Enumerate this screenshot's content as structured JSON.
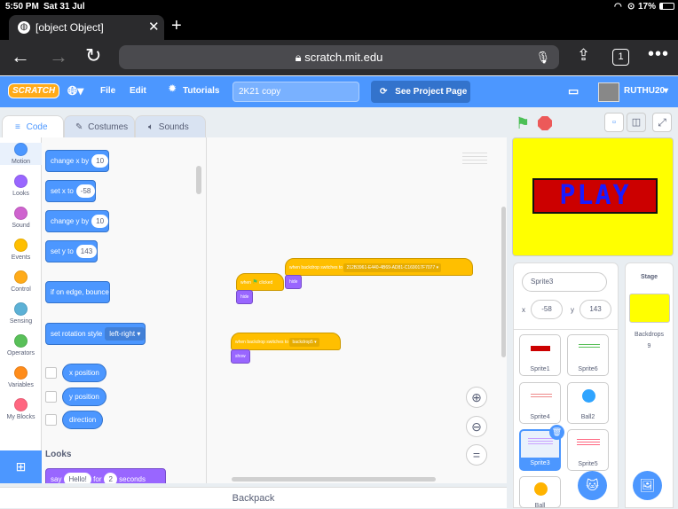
{
  "status_bar": {
    "time": "5:50 PM",
    "date": "Sat 31 Jul",
    "battery": "17%"
  },
  "browser": {
    "tab_title": "[object Object]",
    "url": "scratch.mit.edu",
    "tabs_count": "1"
  },
  "menubar": {
    "logo": "SCRATCH",
    "file": "File",
    "edit": "Edit",
    "tutorials": "Tutorials",
    "project_title": "2K21 copy",
    "see_project": "See Project Page",
    "username": "RUTHU20"
  },
  "editor_tabs": {
    "code": "Code",
    "costumes": "Costumes",
    "sounds": "Sounds"
  },
  "categories": [
    {
      "label": "Motion",
      "color": "#4c97ff"
    },
    {
      "label": "Looks",
      "color": "#9966ff"
    },
    {
      "label": "Sound",
      "color": "#cf63cf"
    },
    {
      "label": "Events",
      "color": "#ffbf00"
    },
    {
      "label": "Control",
      "color": "#ffab19"
    },
    {
      "label": "Sensing",
      "color": "#5cb1d6"
    },
    {
      "label": "Operators",
      "color": "#59c059"
    },
    {
      "label": "Variables",
      "color": "#ff8c1a"
    },
    {
      "label": "My Blocks",
      "color": "#ff6680"
    }
  ],
  "palette": {
    "change_x": {
      "label": "change x by",
      "value": "10"
    },
    "set_x": {
      "label": "set x to",
      "value": "-58"
    },
    "change_y": {
      "label": "change y by",
      "value": "10"
    },
    "set_y": {
      "label": "set y to",
      "value": "143"
    },
    "bounce": "if on edge, bounce",
    "rotation": {
      "label": "set rotation style",
      "value": "left-right"
    },
    "x_position": "x position",
    "y_position": "y position",
    "direction": "direction",
    "looks_header": "Looks",
    "say": {
      "label": "say",
      "text": "Hello!",
      "for": "for",
      "secs": "2",
      "unit": "seconds"
    }
  },
  "code": {
    "when_flag_clicked_a": "when",
    "when_flag_clicked_b": "clicked",
    "hide1": "hide",
    "backdrop_switch1": "when backdrop switches to",
    "backdrop_value1": "212B3961-E440-4B69-AD81-C169017F7077",
    "hide2": "hide",
    "backdrop_switch2": "when backdrop switches to",
    "backdrop_value2": "backdrop5",
    "show": "show"
  },
  "stage": {
    "play_text": "PLAY"
  },
  "sprite_info": {
    "name": "Sprite3",
    "x_label": "x",
    "x": "-58",
    "y_label": "y",
    "y": "143"
  },
  "sprites": [
    {
      "name": "Sprite1"
    },
    {
      "name": "Sprite6"
    },
    {
      "name": "Sprite4"
    },
    {
      "name": "Ball2"
    },
    {
      "name": "Sprite3"
    },
    {
      "name": "Sprite5"
    },
    {
      "name": "Ball"
    }
  ],
  "stage_pane": {
    "title": "Stage",
    "backdrops_label": "Backdrops",
    "backdrops_count": "9"
  },
  "backpack": "Backpack"
}
